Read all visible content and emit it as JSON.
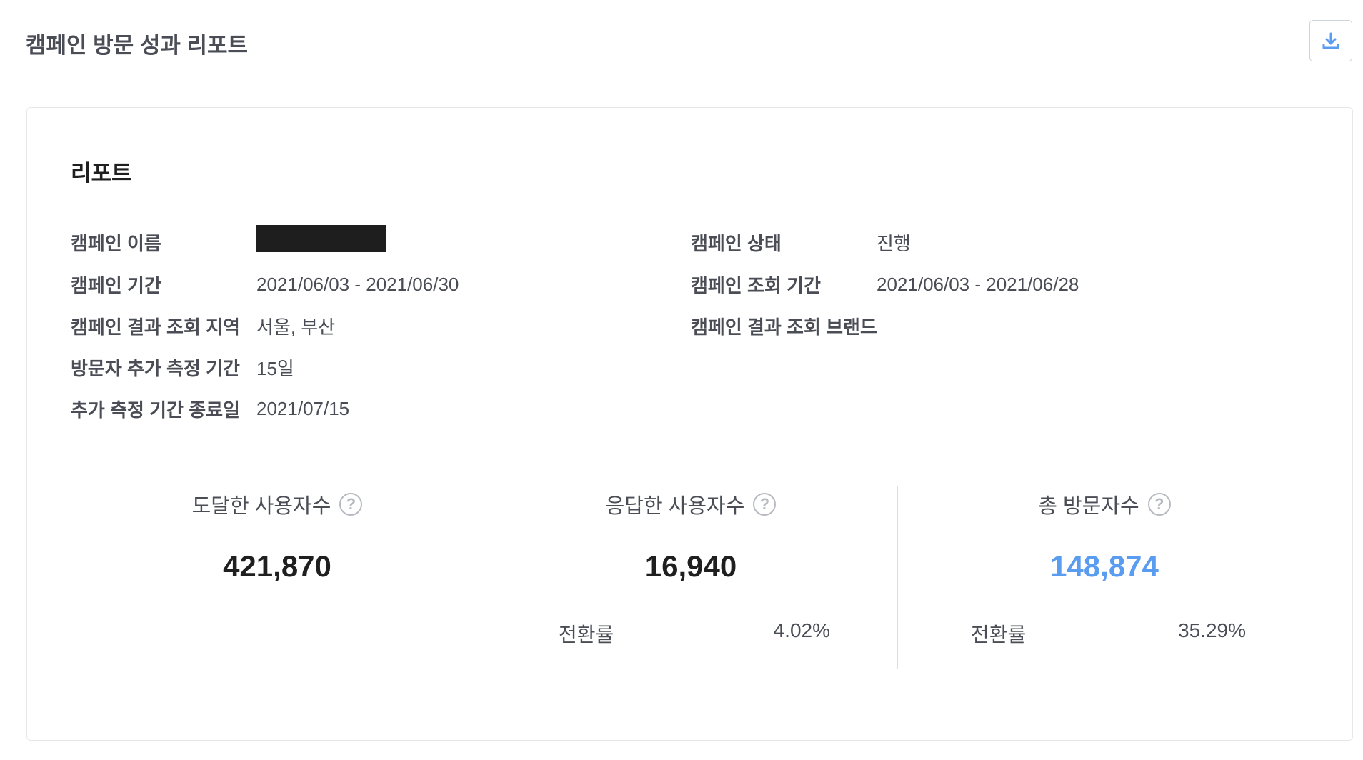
{
  "header": {
    "title": "캠페인 방문 성과 리포트",
    "download_icon": "download-icon"
  },
  "report": {
    "section_title": "리포트",
    "left_fields": [
      {
        "label": "캠페인 이름",
        "value": ""
      },
      {
        "label": "캠페인 기간",
        "value": "2021/06/03 - 2021/06/30"
      },
      {
        "label": "캠페인 결과 조회 지역",
        "value": "서울, 부산"
      },
      {
        "label": "방문자 추가 측정 기간",
        "value": "15일"
      },
      {
        "label": "추가 측정 기간 종료일",
        "value": "2021/07/15"
      }
    ],
    "right_fields": [
      {
        "label": "캠페인 상태",
        "value": "진행"
      },
      {
        "label": "캠페인 조회 기간",
        "value": "2021/06/03 - 2021/06/28"
      },
      {
        "label": "캠페인 결과 조회 브랜드",
        "value": ""
      }
    ]
  },
  "stats": [
    {
      "label": "도달한 사용자수",
      "help": "?",
      "value": "421,870",
      "rate_label": "",
      "rate_value": ""
    },
    {
      "label": "응답한 사용자수",
      "help": "?",
      "value": "16,940",
      "rate_label": "전환률",
      "rate_value": "4.02%"
    },
    {
      "label": "총 방문자수",
      "help": "?",
      "value": "148,874",
      "rate_label": "전환률",
      "rate_value": "35.29%"
    }
  ],
  "colors": {
    "accent": "#5a9cf0",
    "text_dark": "#1f1f1f",
    "text_label": "#4a4d55"
  }
}
